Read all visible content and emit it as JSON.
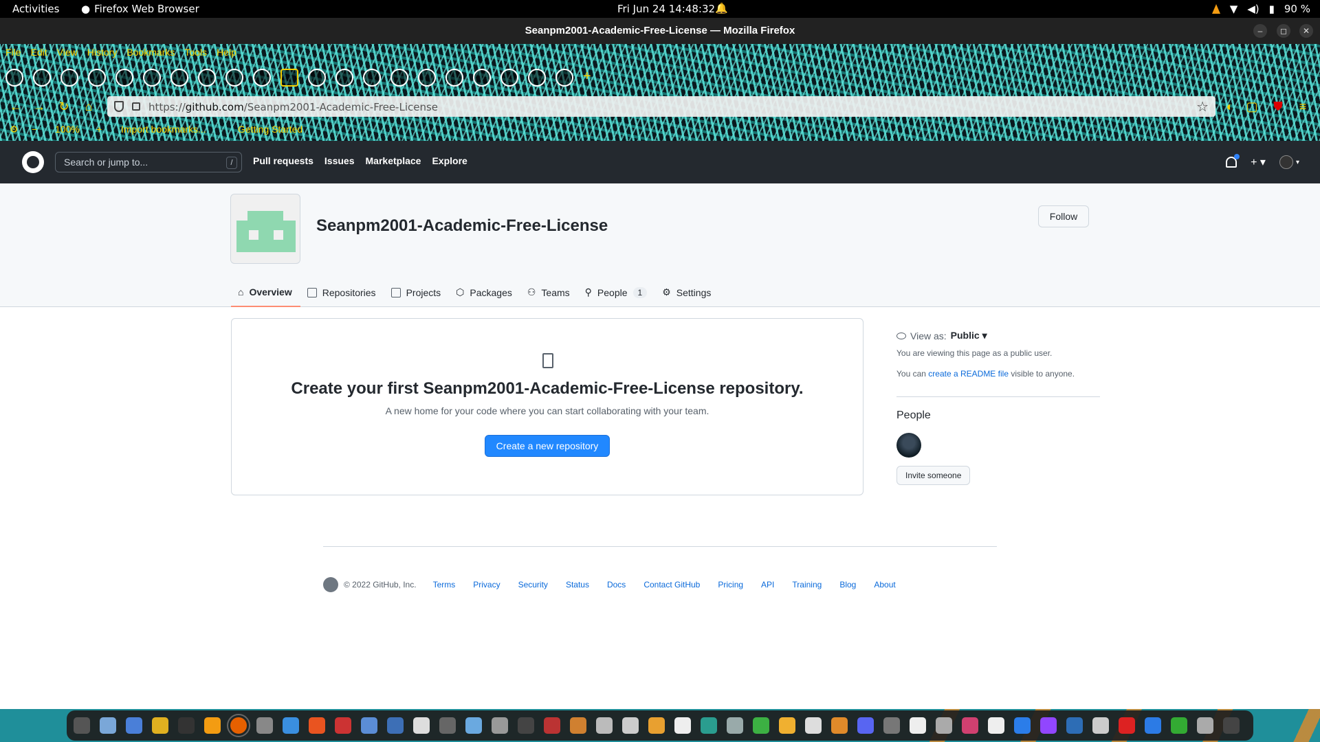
{
  "system": {
    "activities": "Activities",
    "app_name": "Firefox Web Browser",
    "clock": "Fri Jun 24  14:48:32",
    "battery": "90 %"
  },
  "window": {
    "title": "Seanpm2001-Academic-Free-License — Mozilla Firefox"
  },
  "browser": {
    "menu": [
      "File",
      "Edit",
      "View",
      "History",
      "Bookmarks",
      "Tools",
      "Help"
    ],
    "url_prefix": "https://",
    "url_domain": "github.com",
    "url_path": "/Seanpm2001-Academic-Free-License",
    "zoom": "100%",
    "bookmark_import": "Import bookmarks...",
    "bookmark_getting_started": "Getting Started"
  },
  "github": {
    "search_placeholder": "Search or jump to...",
    "search_shortcut": "/",
    "nav": [
      "Pull requests",
      "Issues",
      "Marketplace",
      "Explore"
    ],
    "plus": "+ ▾"
  },
  "org": {
    "name": "Seanpm2001-Academic-Free-License",
    "follow_label": "Follow",
    "tabs": [
      {
        "label": "Overview",
        "icon": "home-icon"
      },
      {
        "label": "Repositories",
        "icon": "repo-icon"
      },
      {
        "label": "Projects",
        "icon": "table-icon"
      },
      {
        "label": "Packages",
        "icon": "package-icon"
      },
      {
        "label": "Teams",
        "icon": "people-icon"
      },
      {
        "label": "People",
        "icon": "person-icon",
        "count": "1"
      },
      {
        "label": "Settings",
        "icon": "gear-icon"
      }
    ]
  },
  "blankslate": {
    "title": "Create your first Seanpm2001-Academic-Free-License repository.",
    "subtitle": "A new home for your code where you can start collaborating with your team.",
    "button": "Create a new repository"
  },
  "sidebar": {
    "view_as_label": "View as:",
    "view_as_value": "Public ▾",
    "public_note": "You are viewing this page as a public user.",
    "readme_prefix": "You can",
    "readme_link": "create a README file",
    "readme_suffix": "visible to anyone.",
    "people_heading": "People",
    "invite_label": "Invite someone"
  },
  "footer": {
    "copyright": "© 2022 GitHub, Inc.",
    "links": [
      "Terms",
      "Privacy",
      "Security",
      "Status",
      "Docs",
      "Contact GitHub",
      "Pricing",
      "API",
      "Training",
      "Blog",
      "About"
    ]
  },
  "colors": {
    "gh_header": "#24292f",
    "accent_blue": "#2188ff",
    "link": "#0969da",
    "tab_underline": "#fd8c73",
    "theme_cyan": "#5ae6dc",
    "theme_yellow": "#f5d000"
  }
}
